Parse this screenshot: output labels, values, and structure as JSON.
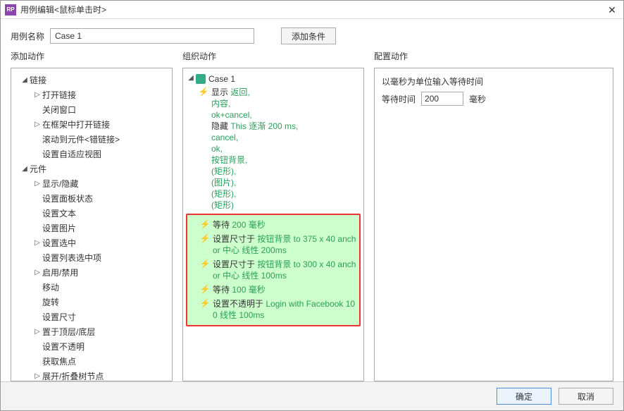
{
  "titlebar": {
    "app_icon": "RP",
    "title": "用例编辑<鼠标单击时>",
    "close": "✕"
  },
  "case_name_label": "用例名称",
  "case_name_value": "Case 1",
  "add_condition_btn": "添加条件",
  "section_labels": {
    "add_action": "添加动作",
    "organize_action": "组织动作",
    "config_action": "配置动作"
  },
  "action_tree": {
    "group1": {
      "label": "链接"
    },
    "items1": [
      {
        "caret": "▷",
        "label": "打开链接"
      },
      {
        "caret": "",
        "label": "关闭窗口"
      },
      {
        "caret": "▷",
        "label": "在框架中打开链接"
      },
      {
        "caret": "",
        "label": "滚动到元件<错链接>"
      },
      {
        "caret": "",
        "label": "设置自适应视图"
      }
    ],
    "group2": {
      "label": "元件"
    },
    "items2": [
      {
        "caret": "▷",
        "label": "显示/隐藏"
      },
      {
        "caret": "",
        "label": "设置面板状态"
      },
      {
        "caret": "",
        "label": "设置文本"
      },
      {
        "caret": "",
        "label": "设置图片"
      },
      {
        "caret": "▷",
        "label": "设置选中"
      },
      {
        "caret": "",
        "label": "设置列表选中项"
      },
      {
        "caret": "▷",
        "label": "启用/禁用"
      },
      {
        "caret": "",
        "label": "移动"
      },
      {
        "caret": "",
        "label": "旋转"
      },
      {
        "caret": "",
        "label": "设置尺寸"
      },
      {
        "caret": "▷",
        "label": "置于顶层/底层"
      },
      {
        "caret": "",
        "label": "设置不透明"
      },
      {
        "caret": "",
        "label": "获取焦点"
      },
      {
        "caret": "▷",
        "label": "展开/折叠树节点"
      }
    ]
  },
  "organize": {
    "case_label": "Case 1",
    "first_action": {
      "prefix": "显示 ",
      "lines": [
        "返回,",
        "内容,",
        "ok+cancel,",
        {
          "t1": "隐藏 ",
          "t2": "This 逐渐 200 ms,"
        },
        "cancel,",
        "ok,",
        "按钮背景,",
        "(矩形),",
        "(图片),",
        "(矩形),",
        "(矩形)"
      ]
    },
    "hl_actions": [
      {
        "p": "等待 ",
        "g": "200 毫秒"
      },
      {
        "p": "设置尺寸于 ",
        "g": "按钮背景 to 375 x 40 anchor 中心 线性 200ms"
      },
      {
        "p": "设置尺寸于 ",
        "g": "按钮背景 to 300 x 40 anchor 中心 线性 100ms"
      },
      {
        "p": "等待 ",
        "g": "100 毫秒"
      },
      {
        "p": "设置不透明于 ",
        "g": "Login with Facebook 100 线性 100ms"
      }
    ]
  },
  "config": {
    "heading": "以毫秒为单位输入等待时间",
    "wait_label": "等待时间",
    "wait_value": "200",
    "wait_unit": "毫秒"
  },
  "footer": {
    "ok": "确定",
    "cancel": "取消"
  }
}
